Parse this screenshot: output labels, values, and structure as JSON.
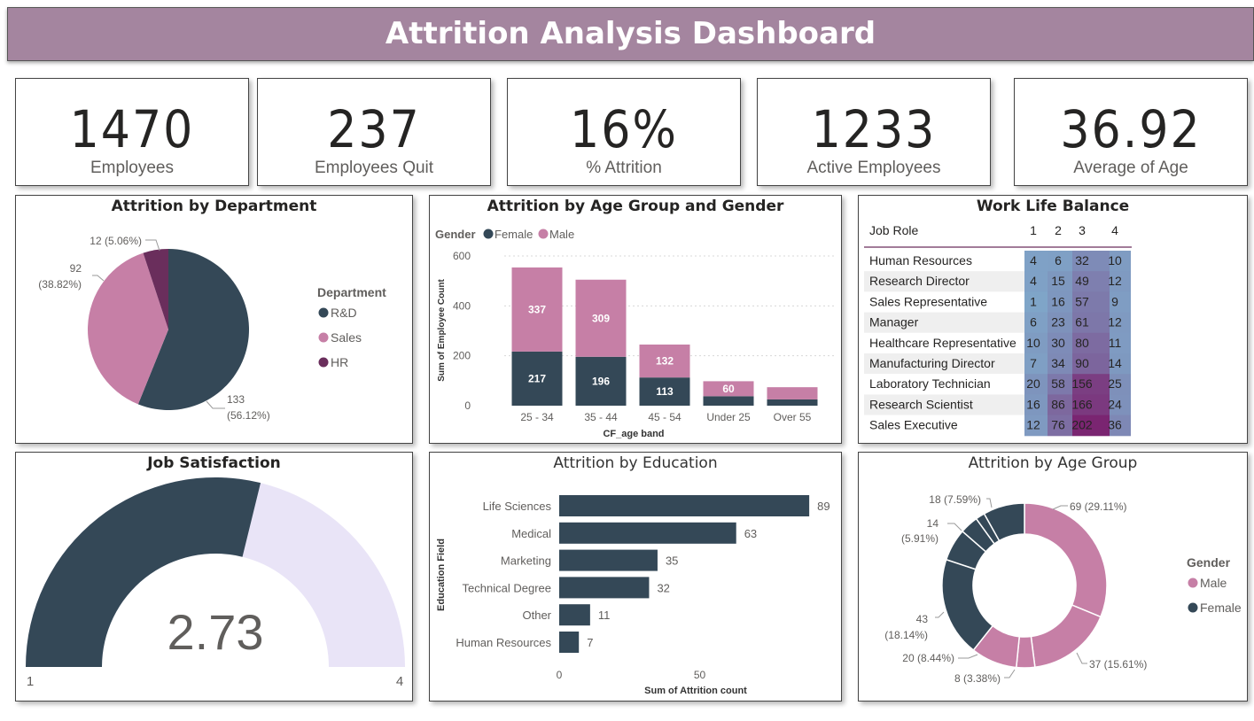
{
  "title": "Attrition Analysis Dashboard",
  "colors": {
    "dark": "#344857",
    "pink": "#c67fa6",
    "purple": "#6a2e5c",
    "gauge_bg": "#e9e4f7",
    "header_bg": "#a4859f"
  },
  "kpis": [
    {
      "value": "1470",
      "label": "Employees"
    },
    {
      "value": "237",
      "label": "Employees Quit"
    },
    {
      "value": "16%",
      "label": "% Attrition"
    },
    {
      "value": "1233",
      "label": "Active Employees"
    },
    {
      "value": "36.92",
      "label": "Average of Age"
    }
  ],
  "chart_data": [
    {
      "type": "pie",
      "title": "Attrition by Department",
      "legend_title": "Department",
      "legend_position": "right",
      "slices": [
        {
          "label": "R&D",
          "value": 133,
          "display": "133",
          "pct": "(56.12%)"
        },
        {
          "label": "Sales",
          "value": 92,
          "display": "92",
          "pct": "(38.82%)"
        },
        {
          "label": "HR",
          "value": 12,
          "display": "12 (5.06%)",
          "pct": ""
        }
      ]
    },
    {
      "type": "bar",
      "stacked": true,
      "title": "Attrition by Age Group and Gender",
      "legend_title": "Gender",
      "legend_position": "top-left",
      "xlabel": "CF_age band",
      "ylabel": "Sum of Employee Count",
      "ylim": [
        0,
        600
      ],
      "yticks": [
        0,
        200,
        400,
        600
      ],
      "categories": [
        "25 - 34",
        "35 - 44",
        "45 - 54",
        "Under 25",
        "Over 55"
      ],
      "series": [
        {
          "name": "Female",
          "values": [
            217,
            196,
            113,
            38,
            25
          ]
        },
        {
          "name": "Male",
          "values": [
            337,
            309,
            132,
            60,
            49
          ]
        }
      ],
      "data_labels": {
        "Female": [
          "217",
          "196",
          "113",
          "",
          ""
        ],
        "Male": [
          "337",
          "309",
          "132",
          "60",
          ""
        ]
      },
      "grid": true
    },
    {
      "type": "heatmap",
      "title": "Work Life Balance",
      "row_header": "Job Role",
      "columns": [
        "1",
        "2",
        "3",
        "4"
      ],
      "rows": [
        "Human Resources",
        "Research Director",
        "Sales Representative",
        "Manager",
        "Healthcare Representative",
        "Manufacturing Director",
        "Laboratory Technician",
        "Research Scientist",
        "Sales Executive"
      ],
      "values": [
        [
          4,
          6,
          32,
          10
        ],
        [
          4,
          15,
          49,
          12
        ],
        [
          1,
          16,
          57,
          9
        ],
        [
          6,
          23,
          61,
          12
        ],
        [
          10,
          30,
          80,
          11
        ],
        [
          7,
          34,
          90,
          14
        ],
        [
          20,
          58,
          156,
          25
        ],
        [
          16,
          86,
          166,
          24
        ],
        [
          12,
          76,
          202,
          36
        ]
      ]
    },
    {
      "type": "gauge",
      "title": "Job Satisfaction",
      "value": 2.73,
      "value_display": "2.73",
      "min": 1,
      "max": 4,
      "min_display": "1",
      "max_display": "4"
    },
    {
      "type": "bar",
      "orientation": "horizontal",
      "title": "Attrition by Education",
      "xlabel": "Sum of Attrition count",
      "ylabel": "Education Field",
      "xlim": [
        0,
        95
      ],
      "xticks": [
        0,
        50
      ],
      "categories": [
        "Life Sciences",
        "Medical",
        "Marketing",
        "Technical Degree",
        "Other",
        "Human Resources"
      ],
      "values": [
        89,
        63,
        35,
        32,
        11,
        7
      ]
    },
    {
      "type": "pie",
      "donut": true,
      "title": "Attrition by Age Group",
      "legend_title": "Gender",
      "legend_position": "right",
      "series_names": [
        "Male",
        "Female"
      ],
      "slices": [
        {
          "gender": "Male",
          "value": 69,
          "label": "69 (29.11%)"
        },
        {
          "gender": "Male",
          "value": 37,
          "label": "37 (15.61%)"
        },
        {
          "gender": "Male",
          "value": 8,
          "label": "8 (3.38%)"
        },
        {
          "gender": "Male",
          "value": 20,
          "label": "20 (8.44%)"
        },
        {
          "gender": "Female",
          "value": 43,
          "label": "43",
          "label2": "(18.14%)"
        },
        {
          "gender": "Female",
          "value": 14,
          "label": "14",
          "label2": "(5.91%)"
        },
        {
          "gender": "Female",
          "value": 8,
          "label": ""
        },
        {
          "gender": "Female",
          "value": 4,
          "label": ""
        },
        {
          "gender": "Female",
          "value": 18,
          "label": "18 (7.59%)"
        }
      ]
    }
  ]
}
